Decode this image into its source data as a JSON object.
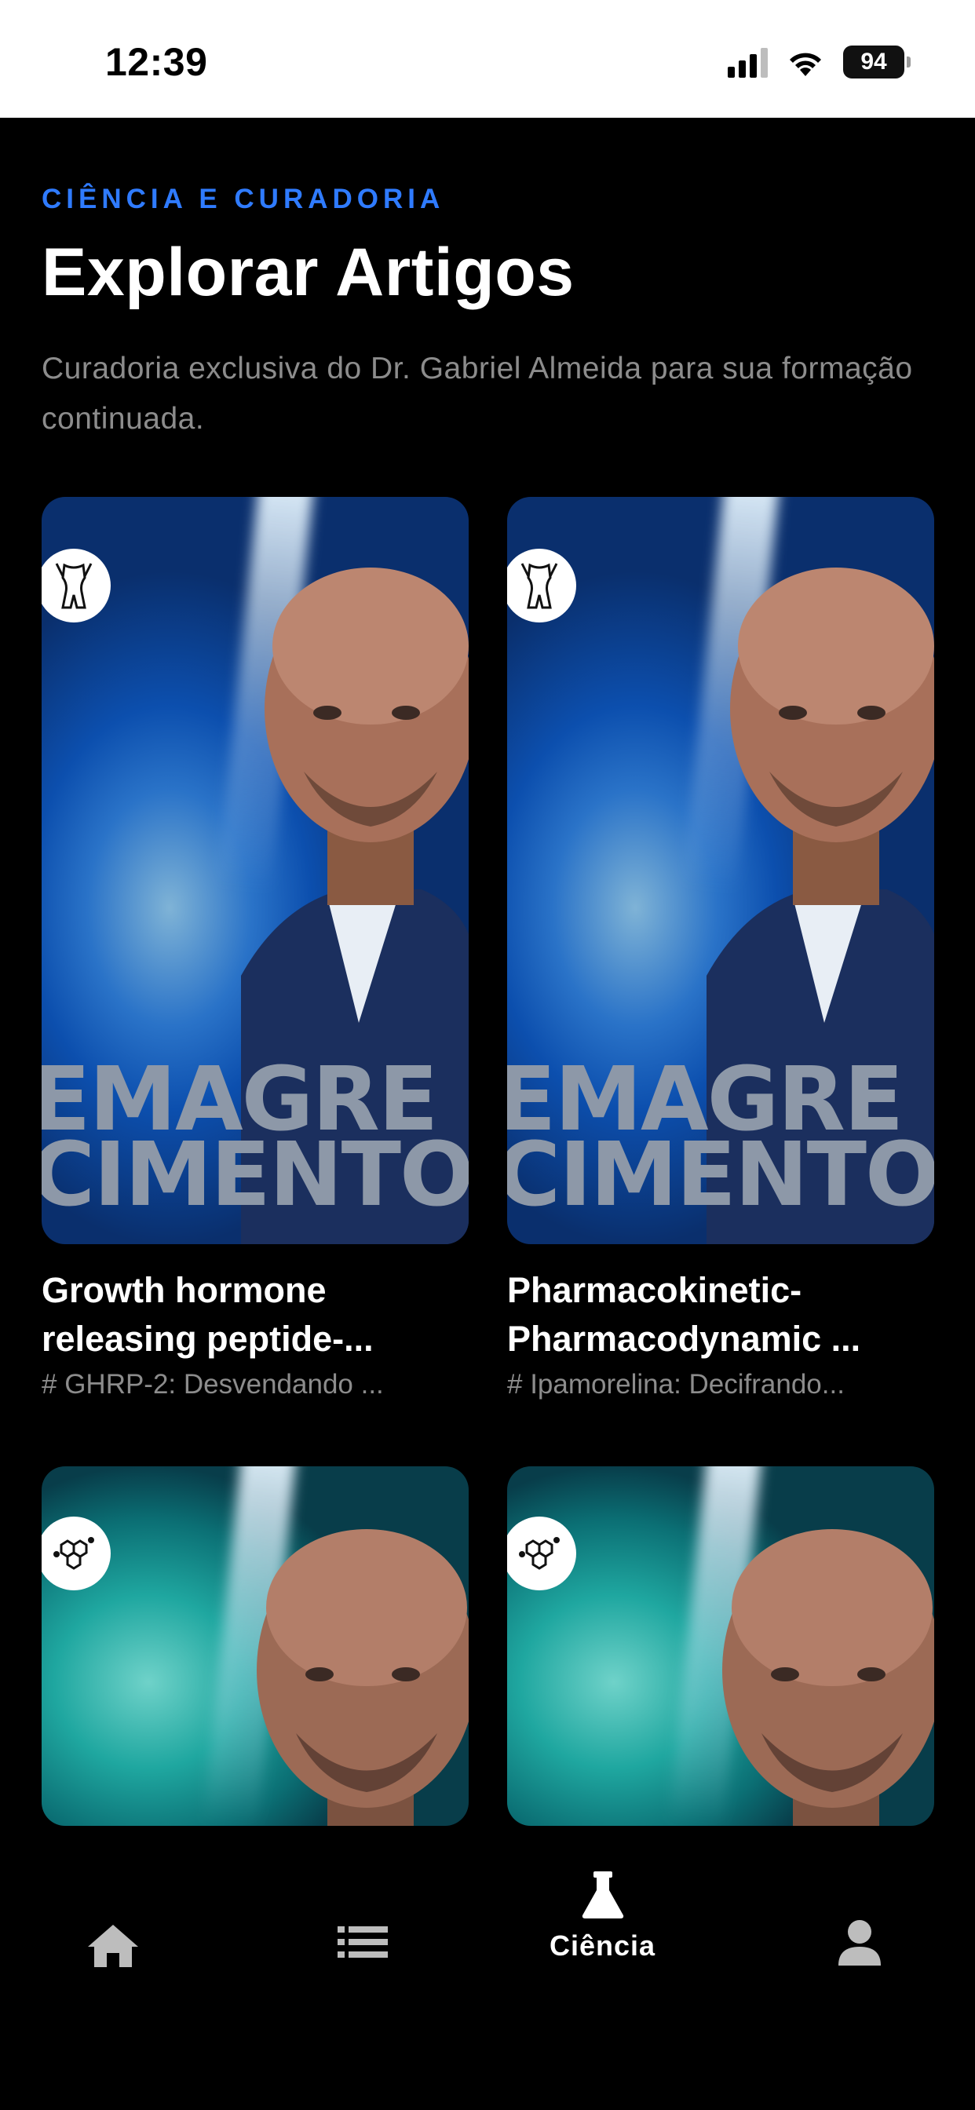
{
  "status_bar": {
    "time": "12:39",
    "battery": "94",
    "icons": [
      "cellular-signal-icon",
      "wifi-icon",
      "battery-icon"
    ]
  },
  "header": {
    "eyebrow": "CIÊNCIA E CURADORIA",
    "title": "Explorar Artigos",
    "subtitle": "Curadoria exclusiva do Dr. Gabriel Almeida para sua formação continuada."
  },
  "articles": [
    {
      "cover_theme": "blue",
      "cover_text": [
        "EMAGRE",
        "CIMENTO"
      ],
      "badge_icon": "body-silhouette-icon",
      "title_lines": [
        "Growth hormone",
        "releasing peptide-..."
      ],
      "excerpt": "# GHRP-2: Desvendando ..."
    },
    {
      "cover_theme": "blue",
      "cover_text": [
        "EMAGRE",
        "CIMENTO"
      ],
      "badge_icon": "body-silhouette-icon",
      "title_lines": [
        "Pharmacokinetic-",
        "Pharmacodynamic ..."
      ],
      "excerpt": "# Ipamorelina: Decifrando..."
    },
    {
      "cover_theme": "teal",
      "badge_icon": "molecule-icon"
    },
    {
      "cover_theme": "teal",
      "badge_icon": "molecule-icon"
    }
  ],
  "bottom_nav": {
    "items": [
      {
        "icon": "home-icon",
        "label": ""
      },
      {
        "icon": "list-icon",
        "label": ""
      },
      {
        "icon": "flask-icon",
        "label": "Ciência",
        "active": true
      },
      {
        "icon": "user-icon",
        "label": ""
      }
    ]
  },
  "colors": {
    "accent": "#2f7bff",
    "background": "#000000",
    "muted_text": "#8c8c8c"
  }
}
